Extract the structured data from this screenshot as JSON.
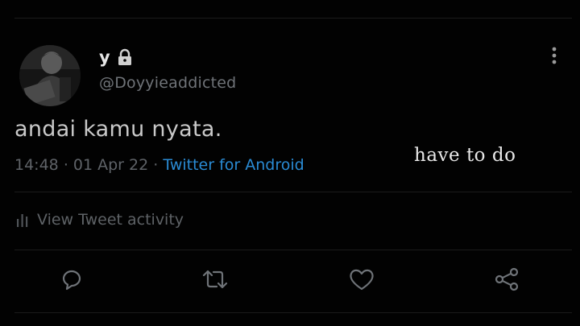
{
  "user": {
    "display_name": "y",
    "handle": "@Doyyieaddicted",
    "protected_icon": "lock-icon",
    "avatar": "profile-photo"
  },
  "tweet": {
    "text": "andai kamu nyata.",
    "time": "14:48",
    "separator": "·",
    "date": "01 Apr 22",
    "source": "Twitter for Android"
  },
  "overlay": {
    "text": "have to do"
  },
  "activity": {
    "label": "View Tweet activity",
    "icon": "bar-chart-icon"
  },
  "actions": [
    {
      "name": "reply",
      "icon": "reply-icon"
    },
    {
      "name": "retweet",
      "icon": "retweet-icon"
    },
    {
      "name": "like",
      "icon": "heart-icon"
    },
    {
      "name": "share",
      "icon": "share-icon"
    }
  ],
  "colors": {
    "background": "#020202",
    "text_primary": "#c9c9c9",
    "text_muted": "#5f6368",
    "link": "#2a8bd4",
    "icon": "#6f7378"
  }
}
